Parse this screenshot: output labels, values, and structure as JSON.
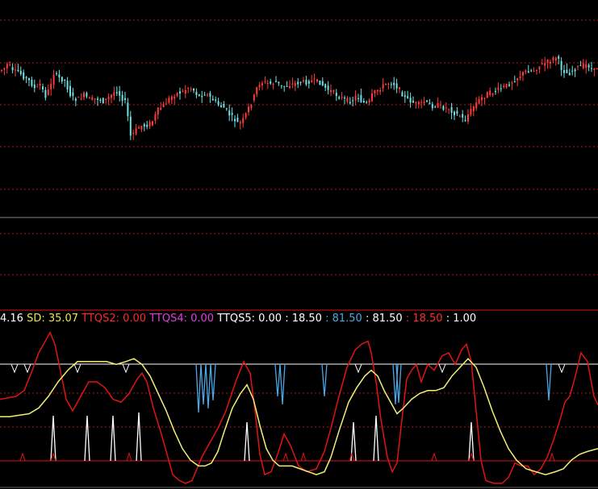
{
  "colors": {
    "background": "#000000",
    "up_candle": "#ff3b3b",
    "down_candle": "#6fe3e3",
    "grid": "#b01818",
    "separator": "#808080",
    "red_line": "#e01414",
    "yellow_line": "#f0f078",
    "white_line": "#ffffff",
    "blue_spike": "#4aa8e6",
    "white_spike": "#ffffff"
  },
  "indicator_legend": [
    {
      "text": "4.16",
      "color": "#ffffff"
    },
    {
      "text": " SD: 35.07",
      "color": "#e8e84a"
    },
    {
      "text": " TTQS2: 0.00",
      "color": "#ff2a2a"
    },
    {
      "text": " TTQS4: 0.00",
      "color": "#e040e0"
    },
    {
      "text": " TTQS5: 0.00",
      "color": "#ffffff"
    },
    {
      "text": " : 18.50",
      "color": "#ffffff"
    },
    {
      "text": " : 81.50",
      "color": "#4aa8e6"
    },
    {
      "text": " : 81.50",
      "color": "#ffffff"
    },
    {
      "text": " : 18.50",
      "color": "#ff2a2a"
    },
    {
      "text": " : 1.00",
      "color": "#ffffff"
    }
  ],
  "chart_data": [
    {
      "type": "candlestick",
      "title": "",
      "grid": true,
      "close_profile": [
        [
          0,
          58
        ],
        [
          6,
          54
        ],
        [
          10,
          48
        ],
        [
          16,
          60
        ],
        [
          22,
          58
        ],
        [
          30,
          66
        ],
        [
          38,
          72
        ],
        [
          44,
          82
        ],
        [
          50,
          74
        ],
        [
          56,
          90
        ],
        [
          62,
          78
        ],
        [
          66,
          60
        ],
        [
          72,
          66
        ],
        [
          80,
          70
        ],
        [
          88,
          90
        ],
        [
          96,
          94
        ],
        [
          104,
          88
        ],
        [
          112,
          94
        ],
        [
          120,
          92
        ],
        [
          128,
          96
        ],
        [
          136,
          90
        ],
        [
          144,
          82
        ],
        [
          150,
          90
        ],
        [
          156,
          98
        ],
        [
          162,
          140
        ],
        [
          168,
          132
        ],
        [
          174,
          126
        ],
        [
          180,
          126
        ],
        [
          188,
          122
        ],
        [
          196,
          106
        ],
        [
          204,
          100
        ],
        [
          210,
          92
        ],
        [
          218,
          86
        ],
        [
          226,
          84
        ],
        [
          234,
          78
        ],
        [
          240,
          82
        ],
        [
          246,
          90
        ],
        [
          254,
          86
        ],
        [
          262,
          92
        ],
        [
          270,
          100
        ],
        [
          278,
          104
        ],
        [
          284,
          112
        ],
        [
          290,
          118
        ],
        [
          296,
          124
        ],
        [
          302,
          118
        ],
        [
          308,
          104
        ],
        [
          314,
          92
        ],
        [
          320,
          74
        ],
        [
          326,
          72
        ],
        [
          334,
          74
        ],
        [
          342,
          72
        ],
        [
          350,
          78
        ],
        [
          356,
          76
        ],
        [
          364,
          74
        ],
        [
          372,
          72
        ],
        [
          380,
          72
        ],
        [
          388,
          70
        ],
        [
          396,
          72
        ],
        [
          404,
          80
        ],
        [
          412,
          84
        ],
        [
          420,
          90
        ],
        [
          428,
          94
        ],
        [
          436,
          96
        ],
        [
          442,
          88
        ],
        [
          448,
          96
        ],
        [
          456,
          100
        ],
        [
          462,
          86
        ],
        [
          470,
          80
        ],
        [
          478,
          74
        ],
        [
          486,
          72
        ],
        [
          494,
          80
        ],
        [
          502,
          92
        ],
        [
          510,
          96
        ],
        [
          518,
          100
        ],
        [
          526,
          96
        ],
        [
          534,
          102
        ],
        [
          542,
          100
        ],
        [
          550,
          104
        ],
        [
          556,
          104
        ],
        [
          562,
          110
        ],
        [
          570,
          114
        ],
        [
          576,
          120
        ],
        [
          580,
          112
        ],
        [
          588,
          100
        ],
        [
          596,
          92
        ],
        [
          604,
          86
        ],
        [
          612,
          84
        ],
        [
          620,
          80
        ],
        [
          628,
          76
        ],
        [
          636,
          70
        ],
        [
          644,
          64
        ],
        [
          652,
          58
        ],
        [
          660,
          58
        ],
        [
          668,
          52
        ],
        [
          676,
          48
        ],
        [
          684,
          44
        ],
        [
          690,
          40
        ],
        [
          696,
          56
        ],
        [
          704,
          62
        ],
        [
          712,
          56
        ],
        [
          720,
          52
        ],
        [
          728,
          50
        ],
        [
          736,
          58
        ],
        [
          741,
          52
        ]
      ]
    },
    {
      "type": "line",
      "title": "",
      "grid": true,
      "x_range": [
        0,
        741
      ],
      "levels": {
        "upper": 81.5,
        "lower": 18.5,
        "bottom": 1.0
      },
      "series": [
        {
          "color": "#e01414",
          "points": [
            [
              0,
              58
            ],
            [
              20,
              60
            ],
            [
              30,
              64
            ],
            [
              40,
              78
            ],
            [
              48,
              90
            ],
            [
              56,
              98
            ],
            [
              62,
              104
            ],
            [
              68,
              96
            ],
            [
              74,
              80
            ],
            [
              82,
              58
            ],
            [
              90,
              50
            ],
            [
              100,
              60
            ],
            [
              110,
              70
            ],
            [
              120,
              70
            ],
            [
              130,
              66
            ],
            [
              140,
              58
            ],
            [
              150,
              56
            ],
            [
              160,
              62
            ],
            [
              170,
              72
            ],
            [
              176,
              76
            ],
            [
              182,
              70
            ],
            [
              190,
              52
            ],
            [
              200,
              34
            ],
            [
              208,
              18
            ],
            [
              214,
              6
            ],
            [
              222,
              2
            ],
            [
              230,
              0
            ],
            [
              238,
              2
            ],
            [
              244,
              10
            ],
            [
              250,
              18
            ],
            [
              256,
              24
            ],
            [
              262,
              30
            ],
            [
              270,
              38
            ],
            [
              280,
              50
            ],
            [
              292,
              70
            ],
            [
              302,
              84
            ],
            [
              310,
              76
            ],
            [
              316,
              50
            ],
            [
              322,
              20
            ],
            [
              328,
              6
            ],
            [
              336,
              8
            ],
            [
              344,
              20
            ],
            [
              352,
              34
            ],
            [
              360,
              26
            ],
            [
              370,
              12
            ],
            [
              380,
              8
            ],
            [
              392,
              10
            ],
            [
              402,
              22
            ],
            [
              410,
              38
            ],
            [
              420,
              60
            ],
            [
              430,
              80
            ],
            [
              440,
              92
            ],
            [
              448,
              96
            ],
            [
              456,
              98
            ],
            [
              460,
              90
            ],
            [
              466,
              70
            ],
            [
              472,
              44
            ],
            [
              480,
              18
            ],
            [
              486,
              8
            ],
            [
              492,
              14
            ],
            [
              498,
              44
            ],
            [
              504,
              72
            ],
            [
              510,
              78
            ],
            [
              516,
              82
            ],
            [
              522,
              70
            ],
            [
              530,
              82
            ],
            [
              538,
              78
            ],
            [
              548,
              88
            ],
            [
              556,
              90
            ],
            [
              564,
              82
            ],
            [
              572,
              92
            ],
            [
              578,
              96
            ],
            [
              584,
              84
            ],
            [
              590,
              50
            ],
            [
              596,
              16
            ],
            [
              602,
              2
            ],
            [
              612,
              0
            ],
            [
              622,
              0
            ],
            [
              630,
              4
            ],
            [
              638,
              14
            ],
            [
              646,
              12
            ],
            [
              654,
              12
            ],
            [
              662,
              6
            ],
            [
              670,
              10
            ],
            [
              678,
              18
            ],
            [
              686,
              30
            ],
            [
              694,
              44
            ],
            [
              700,
              56
            ],
            [
              706,
              60
            ],
            [
              712,
              72
            ],
            [
              720,
              90
            ],
            [
              728,
              84
            ],
            [
              736,
              60
            ],
            [
              741,
              54
            ]
          ]
        },
        {
          "color": "#f0f078",
          "points": [
            [
              0,
              46
            ],
            [
              12,
              46
            ],
            [
              24,
              47
            ],
            [
              36,
              48
            ],
            [
              48,
              52
            ],
            [
              60,
              60
            ],
            [
              72,
              70
            ],
            [
              84,
              78
            ],
            [
              96,
              84
            ],
            [
              108,
              84
            ],
            [
              120,
              84
            ],
            [
              132,
              84
            ],
            [
              144,
              82
            ],
            [
              156,
              84
            ],
            [
              166,
              86
            ],
            [
              176,
              82
            ],
            [
              186,
              74
            ],
            [
              196,
              62
            ],
            [
              206,
              50
            ],
            [
              216,
              36
            ],
            [
              226,
              24
            ],
            [
              236,
              16
            ],
            [
              246,
              12
            ],
            [
              254,
              12
            ],
            [
              262,
              14
            ],
            [
              270,
              22
            ],
            [
              278,
              36
            ],
            [
              288,
              52
            ],
            [
              298,
              62
            ],
            [
              306,
              68
            ],
            [
              314,
              58
            ],
            [
              322,
              40
            ],
            [
              330,
              24
            ],
            [
              338,
              16
            ],
            [
              346,
              12
            ],
            [
              354,
              12
            ],
            [
              362,
              12
            ],
            [
              372,
              10
            ],
            [
              382,
              8
            ],
            [
              392,
              6
            ],
            [
              402,
              8
            ],
            [
              410,
              18
            ],
            [
              420,
              36
            ],
            [
              432,
              56
            ],
            [
              442,
              66
            ],
            [
              452,
              74
            ],
            [
              460,
              78
            ],
            [
              468,
              74
            ],
            [
              476,
              64
            ],
            [
              484,
              56
            ],
            [
              492,
              48
            ],
            [
              500,
              52
            ],
            [
              510,
              58
            ],
            [
              520,
              62
            ],
            [
              530,
              64
            ],
            [
              540,
              64
            ],
            [
              550,
              66
            ],
            [
              560,
              74
            ],
            [
              570,
              80
            ],
            [
              580,
              86
            ],
            [
              590,
              80
            ],
            [
              600,
              66
            ],
            [
              610,
              50
            ],
            [
              620,
              36
            ],
            [
              630,
              24
            ],
            [
              640,
              16
            ],
            [
              652,
              10
            ],
            [
              664,
              8
            ],
            [
              676,
              6
            ],
            [
              688,
              8
            ],
            [
              698,
              10
            ],
            [
              708,
              16
            ],
            [
              718,
              20
            ],
            [
              728,
              22
            ],
            [
              741,
              24
            ]
          ]
        }
      ],
      "blue_spikes_x": [
        246,
        252,
        258,
        264,
        344,
        350,
        402,
        490,
        494,
        680
      ],
      "blue_spike_depth": [
        60,
        50,
        55,
        45,
        40,
        50,
        40,
        50,
        48,
        45
      ],
      "white_spikes_x": [
        66,
        108,
        140,
        172,
        306,
        438,
        466,
        584
      ],
      "white_spike_height": [
        56,
        56,
        56,
        60,
        48,
        48,
        56,
        48
      ],
      "v_markers_x": [
        18,
        34,
        96,
        156,
        444,
        548,
        696
      ],
      "triangle_markers_x": [
        28,
        66,
        160,
        354,
        376,
        436,
        538,
        584,
        684
      ]
    }
  ]
}
